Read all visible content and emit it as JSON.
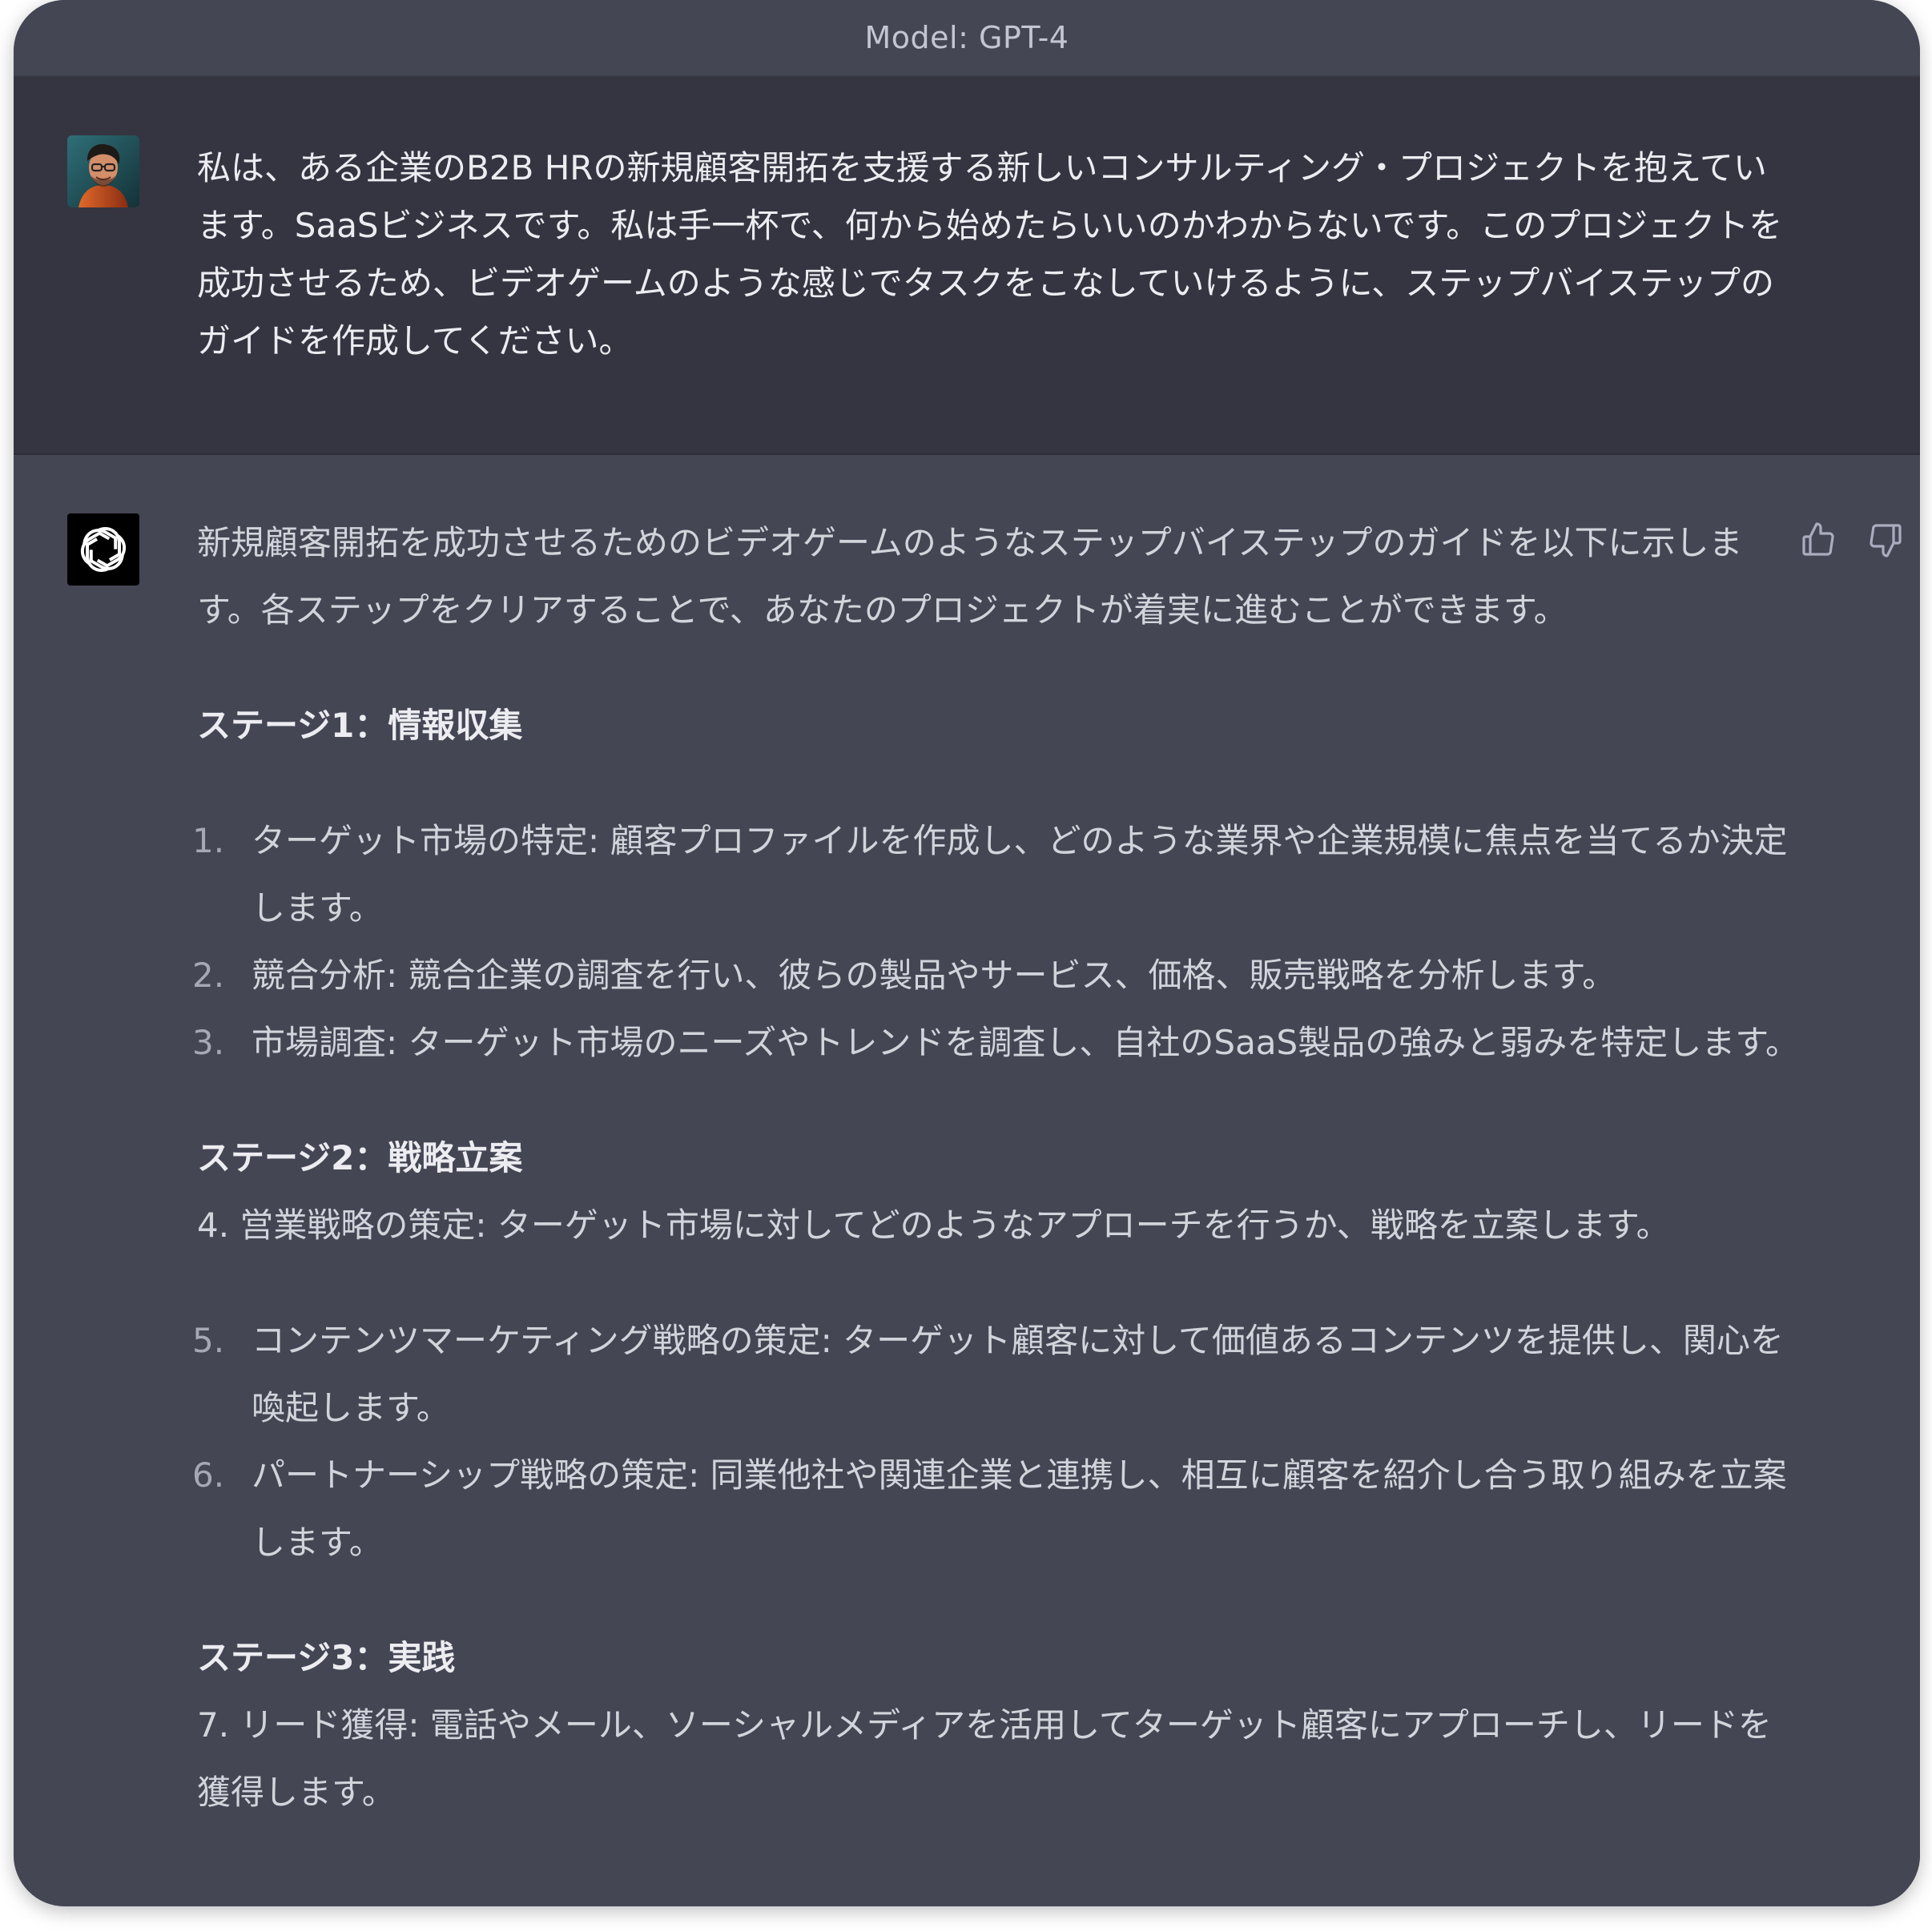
{
  "header": {
    "model_label": "Model: GPT-4"
  },
  "user": {
    "avatar_icon": "user-avatar-portrait",
    "message": "私は、ある企業のB2B HRの新規顧客開拓を支援する新しいコンサルティング・プロジェクトを抱えています。SaaSビジネスです。私は手一杯で、何から始めたらいいのかわからないです。このプロジェクトを成功させるため、ビデオゲームのような感じでタスクをこなしていけるように、ステップバイステップのガイドを作成してください。"
  },
  "assistant": {
    "avatar_icon": "openai-logo-icon",
    "intro": "新規顧客開拓を成功させるためのビデオゲームのようなステップバイステップのガイドを以下に示します。各ステップをクリアすることで、あなたのプロジェクトが着実に進むことができます。",
    "stage1": {
      "heading": "ステージ1：情報収集",
      "items": [
        {
          "num": "1.",
          "text": "ターゲット市場の特定: 顧客プロファイルを作成し、どのような業界や企業規模に焦点を当てるか決定します。"
        },
        {
          "num": "2.",
          "text": "競合分析: 競合企業の調査を行い、彼らの製品やサービス、価格、販売戦略を分析します。"
        },
        {
          "num": "3.",
          "text": "市場調査: ターゲット市場のニーズやトレンドを調査し、自社のSaaS製品の強みと弱みを特定します。"
        }
      ]
    },
    "stage2": {
      "heading": "ステージ2：戦略立案",
      "item4": "4. 営業戦略の策定: ターゲット市場に対してどのようなアプローチを行うか、戦略を立案します。",
      "items": [
        {
          "num": "5.",
          "text": "コンテンツマーケティング戦略の策定: ターゲット顧客に対して価値あるコンテンツを提供し、関心を喚起します。"
        },
        {
          "num": "6.",
          "text": "パートナーシップ戦略の策定: 同業他社や関連企業と連携し、相互に顧客を紹介し合う取り組みを立案します。"
        }
      ]
    },
    "stage3": {
      "heading": "ステージ3：実践",
      "item7": "7. リード獲得: 電話やメール、ソーシャルメディアを活用してターゲット顧客にアプローチし、リードを獲得します。"
    },
    "feedback": {
      "thumbs_up_icon": "thumbs-up-icon",
      "thumbs_down_icon": "thumbs-down-icon"
    }
  },
  "colors": {
    "user_bg": "#343541",
    "assistant_bg": "#444654",
    "text": "#d1d5db"
  }
}
